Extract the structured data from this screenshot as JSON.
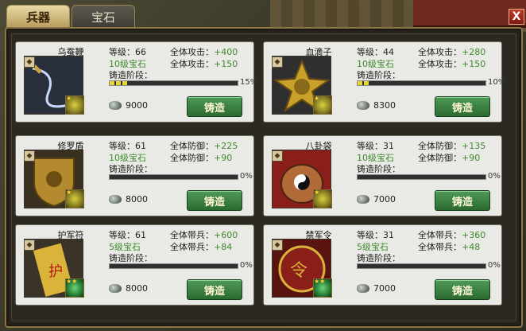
{
  "tabs": {
    "weapons": "兵器",
    "gems": "宝石"
  },
  "close_label": "X",
  "colors": {
    "green_value": "#3d8a2a",
    "button_green": "#2b6a31",
    "bar_fill": "#e6d53a"
  },
  "items": [
    {
      "name": "乌蚕鞭",
      "level": "等级：66",
      "stat1": "全体攻击：",
      "stat1_val": "+400",
      "gem": "10级宝石",
      "stat2": "全体攻击：",
      "stat2_val": "+150",
      "stage_label": "铸造阶段：",
      "progress": "15%",
      "progress_value": 0.15,
      "cost": "9000",
      "button": "铸造",
      "art": "whip-icon",
      "gem_color": "yellow",
      "stars": "★"
    },
    {
      "name": "血滴子",
      "level": "等级：44",
      "stat1": "全体攻击：",
      "stat1_val": "+280",
      "gem": "10级宝石",
      "stat2": "全体攻击：",
      "stat2_val": "+150",
      "stage_label": "铸造阶段：",
      "progress": "10%",
      "progress_value": 0.1,
      "cost": "8300",
      "button": "铸造",
      "art": "blade-disc-icon",
      "gem_color": "yellow",
      "stars": "★"
    },
    {
      "name": "修罗盾",
      "level": "等级：61",
      "stat1": "全体防御：",
      "stat1_val": "+225",
      "gem": "10级宝石",
      "stat2": "全体防御：",
      "stat2_val": "+90",
      "stage_label": "铸造阶段：",
      "progress": "0%",
      "progress_value": 0,
      "cost": "8000",
      "button": "铸造",
      "art": "shield-icon",
      "gem_color": "yellow",
      "stars": "★"
    },
    {
      "name": "八卦袋",
      "level": "等级：31",
      "stat1": "全体防御：",
      "stat1_val": "+135",
      "gem": "10级宝石",
      "stat2": "全体防御：",
      "stat2_val": "+90",
      "stage_label": "铸造阶段：",
      "progress": "0%",
      "progress_value": 0,
      "cost": "7000",
      "button": "铸造",
      "art": "bagua-bag-icon",
      "gem_color": "yellow",
      "stars": "★"
    },
    {
      "name": "护军符",
      "level": "等级：61",
      "stat1": "全体带兵：",
      "stat1_val": "+600",
      "gem": "5级宝石",
      "stat2": "全体带兵：",
      "stat2_val": "+84",
      "stage_label": "铸造阶段：",
      "progress": "0%",
      "progress_value": 0,
      "cost": "8000",
      "button": "铸造",
      "art": "talisman-icon",
      "gem_color": "green",
      "stars": "★★"
    },
    {
      "name": "禁军令",
      "level": "等级：31",
      "stat1": "全体带兵：",
      "stat1_val": "+360",
      "gem": "5级宝石",
      "stat2": "全体带兵：",
      "stat2_val": "+48",
      "stage_label": "铸造阶段：",
      "progress": "0%",
      "progress_value": 0,
      "cost": "7000",
      "button": "铸造",
      "art": "command-token-icon",
      "gem_color": "green",
      "stars": "★★"
    }
  ]
}
